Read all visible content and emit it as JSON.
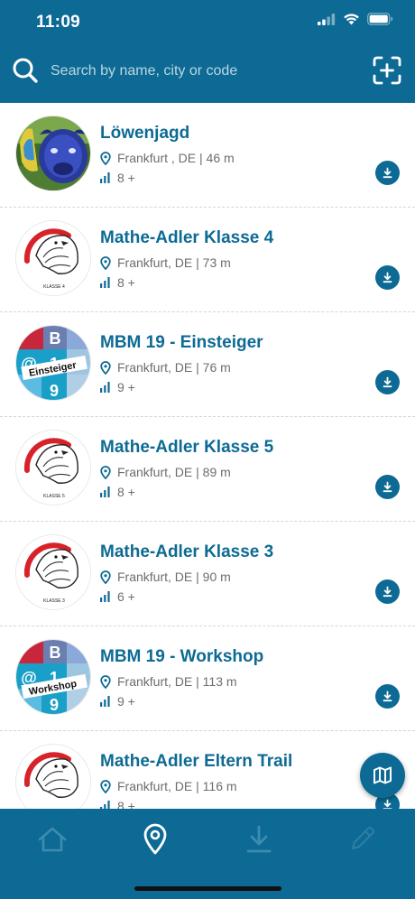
{
  "status": {
    "time": "11:09"
  },
  "search": {
    "placeholder": "Search by name, city or code"
  },
  "icons": {
    "search": "search-icon",
    "scan": "scan-add-icon",
    "download": "download-icon",
    "pin": "location-pin-icon",
    "difficulty": "difficulty-bars-icon",
    "map": "map-icon"
  },
  "colors": {
    "brand": "#0d6a94",
    "text_secondary": "#6d6d6d",
    "tab_inactive": "#3d8bb0"
  },
  "trails": [
    {
      "name": "Löwenjagd",
      "location": "Frankfurt , DE | 46 m",
      "level": "8 +",
      "image": "photo-lion-statue"
    },
    {
      "name": "Mathe-Adler Klasse 4",
      "location": "Frankfurt, DE | 73 m",
      "level": "8 +",
      "image": "eagle-logo",
      "badge": "KLASSE 4"
    },
    {
      "name": "MBM 19 - Einsteiger",
      "location": "Frankfurt, DE | 76 m",
      "level": "9 +",
      "image": "mbm-logo",
      "badge": "Einsteiger"
    },
    {
      "name": "Mathe-Adler Klasse 5",
      "location": "Frankfurt, DE | 89 m",
      "level": "8 +",
      "image": "eagle-logo",
      "badge": "KLASSE 5"
    },
    {
      "name": "Mathe-Adler Klasse 3",
      "location": "Frankfurt, DE | 90 m",
      "level": "6 +",
      "image": "eagle-logo",
      "badge": "KLASSE 3"
    },
    {
      "name": "MBM 19 - Workshop",
      "location": "Frankfurt, DE | 113 m",
      "level": "9 +",
      "image": "mbm-logo",
      "badge": "Workshop"
    },
    {
      "name": "Mathe-Adler Eltern Trail",
      "location": "Frankfurt, DE | 116 m",
      "level": "8 +",
      "image": "eagle-logo",
      "badge": ""
    }
  ],
  "tabs": [
    {
      "id": "home",
      "icon": "home-icon",
      "active": false
    },
    {
      "id": "nearby",
      "icon": "location-icon",
      "active": true
    },
    {
      "id": "downloads",
      "icon": "download-tray-icon",
      "active": false
    },
    {
      "id": "edit",
      "icon": "pencil-icon",
      "active": false,
      "disabled": true
    }
  ]
}
